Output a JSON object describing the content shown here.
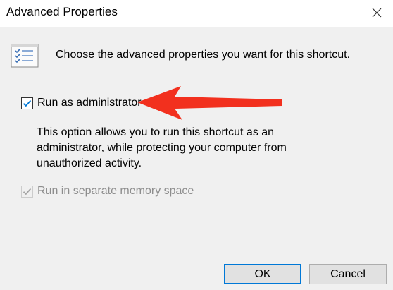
{
  "window": {
    "title": "Advanced Properties"
  },
  "intro": {
    "text": "Choose the advanced properties you want for this shortcut.",
    "icon": "properties-list-icon"
  },
  "options": {
    "run_as_admin": {
      "label": "Run as administrator",
      "checked": true,
      "enabled": true,
      "description": "This option allows you to run this shortcut as an administrator, while protecting your computer from unauthorized activity."
    },
    "separate_memory": {
      "label": "Run in separate memory space",
      "checked": true,
      "enabled": false
    }
  },
  "annotation": {
    "icon": "red-arrow-icon",
    "color": "#f2301e"
  },
  "buttons": {
    "ok": "OK",
    "cancel": "Cancel"
  },
  "colors": {
    "accent": "#0078d7",
    "background": "#f0f0f0",
    "disabled_text": "#8d8d8d"
  }
}
